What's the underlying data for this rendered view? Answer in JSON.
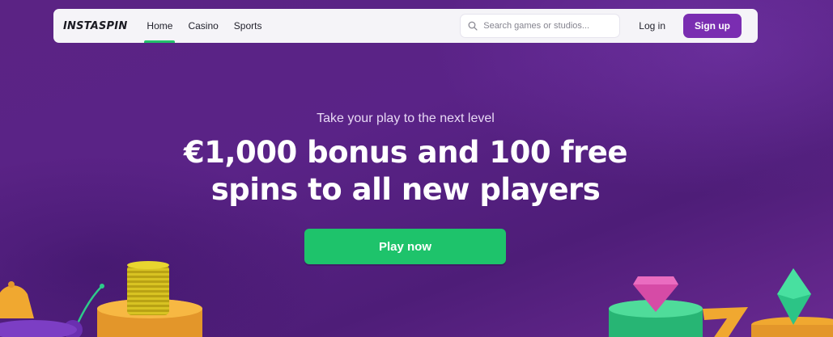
{
  "header": {
    "logo_text": "INSTASPIN",
    "nav": [
      {
        "label": "Home",
        "active": true
      },
      {
        "label": "Casino",
        "active": false
      },
      {
        "label": "Sports",
        "active": false
      }
    ],
    "search": {
      "placeholder": "Search games or studios...",
      "value": "",
      "icon": "search-icon"
    },
    "login_label": "Log in",
    "signup_label": "Sign up"
  },
  "hero": {
    "tagline": "Take your play to the next level",
    "headline_line1": "€1,000 bonus and 100 free",
    "headline_line2": "spins to all new players",
    "cta_label": "Play now"
  },
  "decorations": {
    "left": [
      "bell-icon",
      "coin-stack-icon",
      "cherry-icon",
      "pedestal-icon"
    ],
    "right": [
      "gem-icon",
      "seven-icon",
      "diamond-icon",
      "pedestal-icon"
    ]
  },
  "colors": {
    "background": "#5a2387",
    "accent_green": "#1ec36b",
    "accent_purple": "#7a2db1"
  }
}
